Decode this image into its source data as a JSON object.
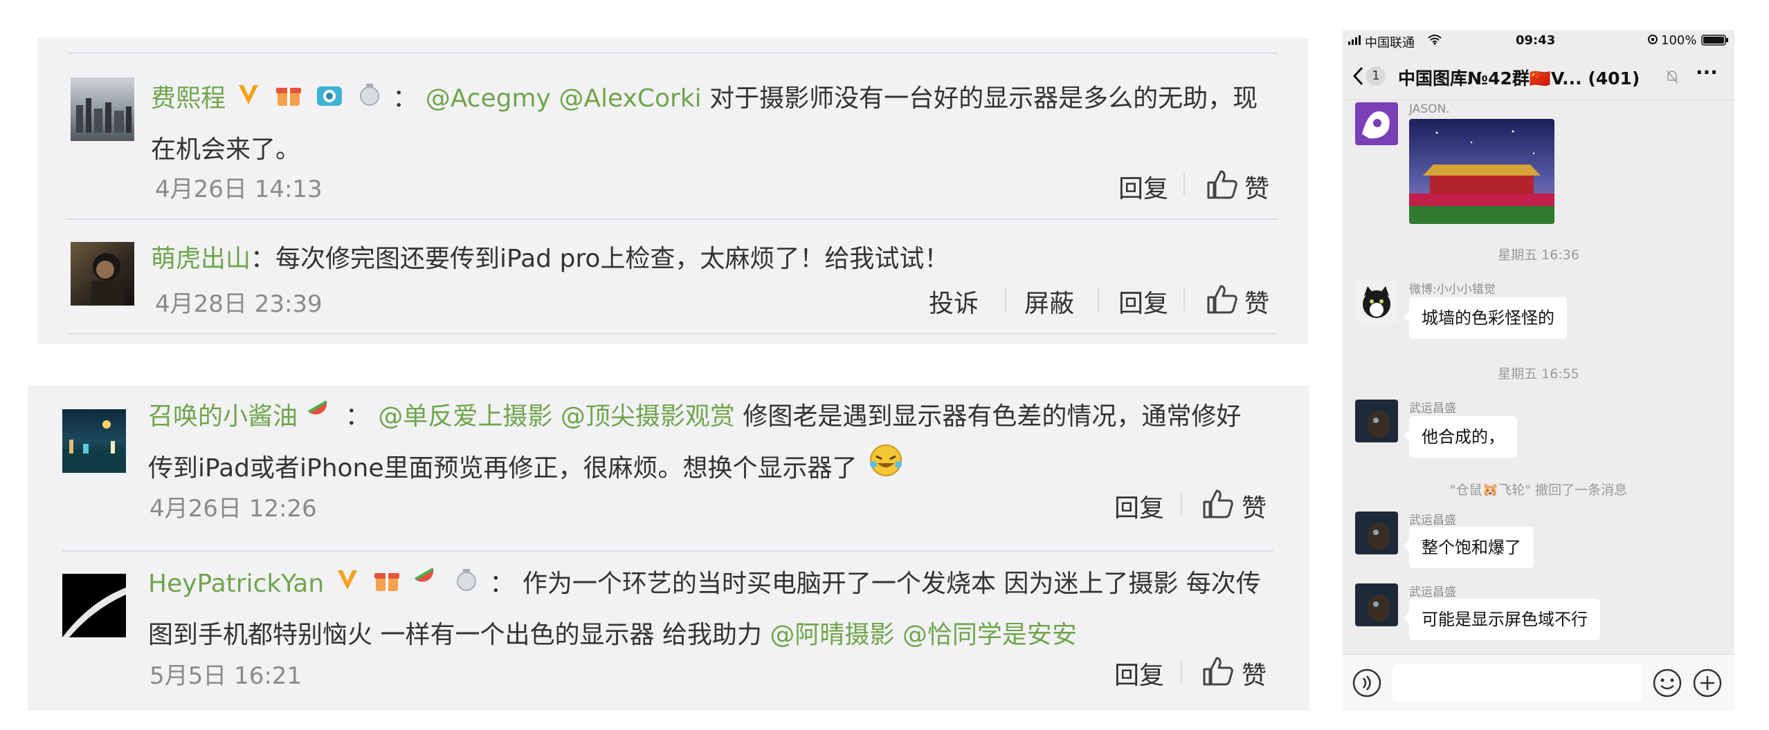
{
  "comments_top": [
    {
      "username": "费熙程",
      "separator": "：",
      "mentions": [
        "@Acegmy",
        "@AlexCorki"
      ],
      "text_line1": "对于摄影师没有一台好的显示器是多么的无助，现",
      "text_line2": "在机会来了。",
      "date": "4月26日 14:13",
      "actions": [
        "回复",
        "赞"
      ]
    },
    {
      "username": "萌虎出山",
      "separator": "：",
      "text_line1": "每次修完图还要传到iPad pro上检查，太麻烦了！给我试试！",
      "date": "4月28日 23:39",
      "actions": [
        "投诉",
        "屏蔽",
        "回复",
        "赞"
      ]
    }
  ],
  "comments_bottom": [
    {
      "username": "召唤的小酱油",
      "separator": "：",
      "mentions": [
        "@单反爱上摄影",
        "@顶尖摄影观赏"
      ],
      "text_line1": "修图老是遇到显示器有色差的情况，通常修好",
      "text_line2": "传到iPad或者iPhone里面预览再修正，很麻烦。想换个显示器了",
      "date": "4月26日 12:26",
      "actions": [
        "回复",
        "赞"
      ]
    },
    {
      "username": "HeyPatrickYan",
      "separator": "：",
      "text_line1": "作为一个环艺的当时买电脑开了一个发烧本 因为迷上了摄影 每次传",
      "text_line2a": "图到手机都特别恼火 一样有一个出色的显示器 给我助力",
      "mentions": [
        "@阿晴摄影",
        "@恰同学是安安"
      ],
      "date": "5月5日 16:21",
      "actions": [
        "回复",
        "赞"
      ]
    }
  ],
  "phone": {
    "status": {
      "carrier": "中国联通",
      "time": "09:43",
      "battery": "100%"
    },
    "nav": {
      "back_badge": "1",
      "title": "中国图库№42群🇨🇳V... (401)",
      "more": "···"
    },
    "messages": [
      {
        "sender": "JASON.",
        "type": "image"
      },
      {
        "system": "星期五 16:36"
      },
      {
        "sender": "微博:小小小错觉",
        "text": "城墙的色彩怪怪的"
      },
      {
        "system": "星期五 16:55"
      },
      {
        "sender": "武运昌盛",
        "text": "他合成的，"
      },
      {
        "system": "\"仓鼠🐹飞轮\" 撤回了一条消息"
      },
      {
        "sender": "武运昌盛",
        "text": "整个饱和爆了"
      },
      {
        "sender": "武运昌盛",
        "text": "可能是显示屏色域不行"
      }
    ]
  },
  "colors": {
    "username": "#6fa54b",
    "panel_bg": "#f2f2f5",
    "chat_bg": "#ededed",
    "vip": "#f4a21c"
  },
  "icons": [
    "vip-v-icon",
    "camera-badge-icon",
    "medal-badge-icon",
    "thumb-up-icon",
    "voice-icon",
    "emoji-icon",
    "plus-icon",
    "wifi-icon",
    "signal-icon",
    "battery-icon",
    "back-chevron-icon",
    "mute-icon",
    "more-icon"
  ]
}
